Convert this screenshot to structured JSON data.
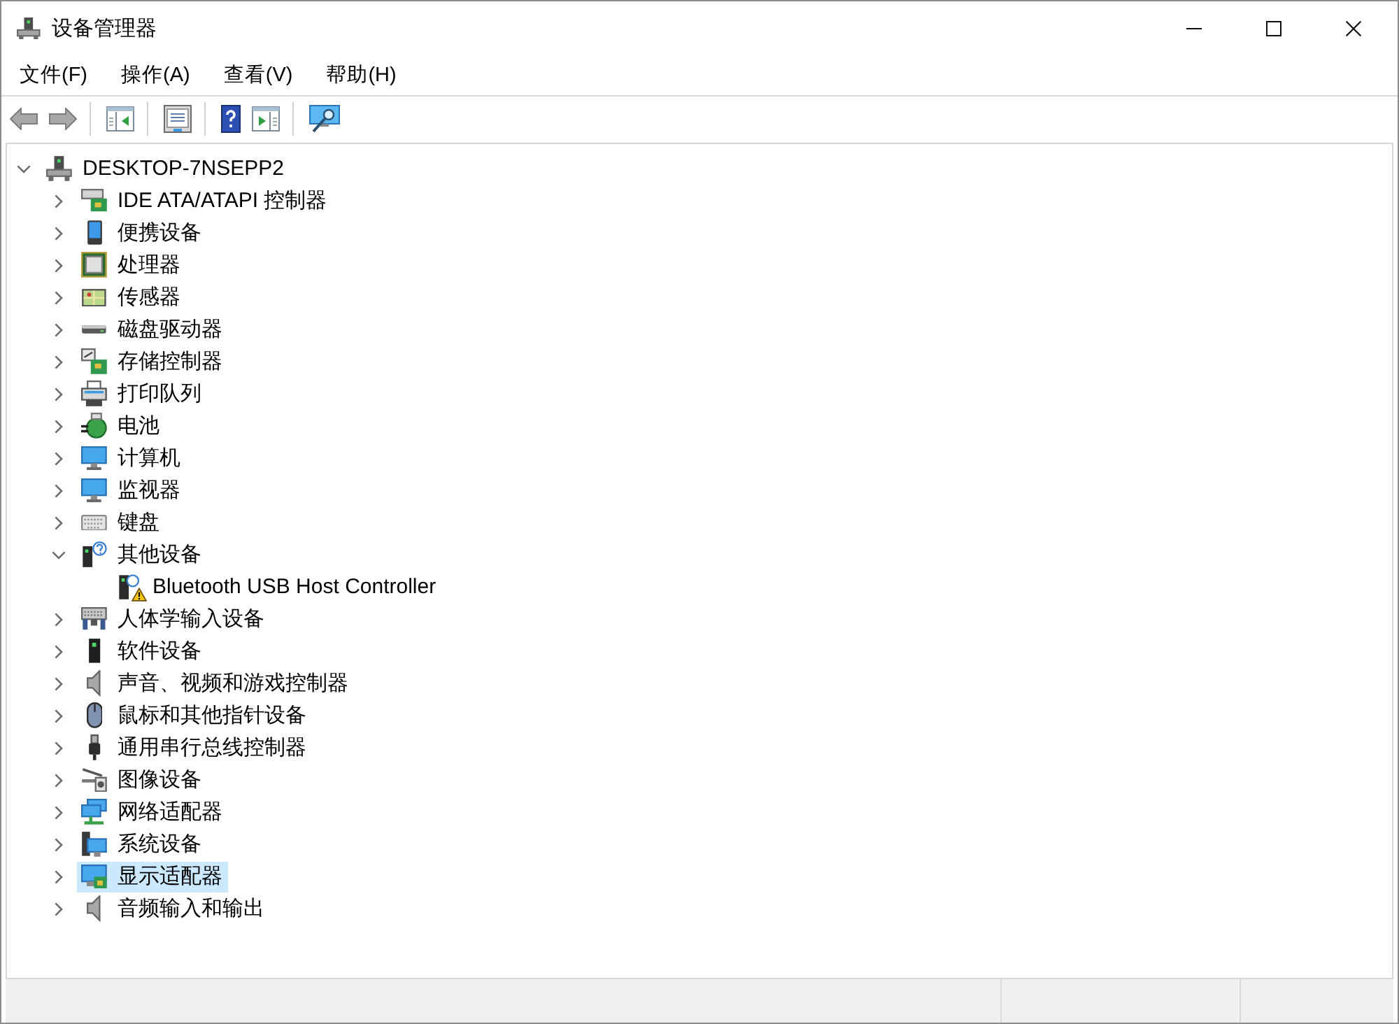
{
  "window": {
    "title": "设备管理器"
  },
  "menu": [
    "文件(F)",
    "操作(A)",
    "查看(V)",
    "帮助(H)"
  ],
  "toolbar": {
    "groups": [
      {
        "buttons": [
          {
            "kind": "back",
            "disabled": true
          },
          {
            "kind": "forward",
            "disabled": true
          }
        ]
      },
      {
        "buttons": [
          {
            "kind": "console-tree",
            "disabled": false
          }
        ]
      },
      {
        "buttons": [
          {
            "kind": "properties",
            "disabled": false
          }
        ]
      },
      {
        "buttons": [
          {
            "kind": "help",
            "disabled": false
          },
          {
            "kind": "action-pane",
            "disabled": false
          }
        ]
      },
      {
        "buttons": [
          {
            "kind": "scan",
            "disabled": false
          }
        ]
      }
    ]
  },
  "tree": {
    "root": {
      "label": "DESKTOP-7NSEPP2",
      "kind": "computer",
      "expanded": true,
      "selected": false,
      "children": [
        {
          "label": "IDE ATA/ATAPI 控制器",
          "kind": "ide",
          "expanded": false,
          "selected": false
        },
        {
          "label": "便携设备",
          "kind": "portable",
          "expanded": false,
          "selected": false
        },
        {
          "label": "处理器",
          "kind": "processor",
          "expanded": false,
          "selected": false
        },
        {
          "label": "传感器",
          "kind": "sensor",
          "expanded": false,
          "selected": false
        },
        {
          "label": "磁盘驱动器",
          "kind": "disk",
          "expanded": false,
          "selected": false
        },
        {
          "label": "存储控制器",
          "kind": "storage",
          "expanded": false,
          "selected": false
        },
        {
          "label": "打印队列",
          "kind": "printer",
          "expanded": false,
          "selected": false
        },
        {
          "label": "电池",
          "kind": "battery",
          "expanded": false,
          "selected": false
        },
        {
          "label": "计算机",
          "kind": "monitor",
          "expanded": false,
          "selected": false
        },
        {
          "label": "监视器",
          "kind": "monitor",
          "expanded": false,
          "selected": false
        },
        {
          "label": "键盘",
          "kind": "keyboard",
          "expanded": false,
          "selected": false
        },
        {
          "label": "其他设备",
          "kind": "other",
          "expanded": true,
          "selected": false,
          "children": [
            {
              "label": "Bluetooth USB Host Controller",
              "kind": "device",
              "warning": true,
              "selected": false
            }
          ]
        },
        {
          "label": "人体学输入设备",
          "kind": "hid",
          "expanded": false,
          "selected": false
        },
        {
          "label": "软件设备",
          "kind": "software",
          "expanded": false,
          "selected": false
        },
        {
          "label": "声音、视频和游戏控制器",
          "kind": "speaker",
          "expanded": false,
          "selected": false
        },
        {
          "label": "鼠标和其他指针设备",
          "kind": "mouse",
          "expanded": false,
          "selected": false
        },
        {
          "label": "通用串行总线控制器",
          "kind": "usb",
          "expanded": false,
          "selected": false
        },
        {
          "label": "图像设备",
          "kind": "imaging",
          "expanded": false,
          "selected": false
        },
        {
          "label": "网络适配器",
          "kind": "network",
          "expanded": false,
          "selected": false
        },
        {
          "label": "系统设备",
          "kind": "system",
          "expanded": false,
          "selected": false
        },
        {
          "label": "显示适配器",
          "kind": "display",
          "expanded": false,
          "selected": true
        },
        {
          "label": "音频输入和输出",
          "kind": "speaker",
          "expanded": false,
          "selected": false
        }
      ]
    }
  }
}
